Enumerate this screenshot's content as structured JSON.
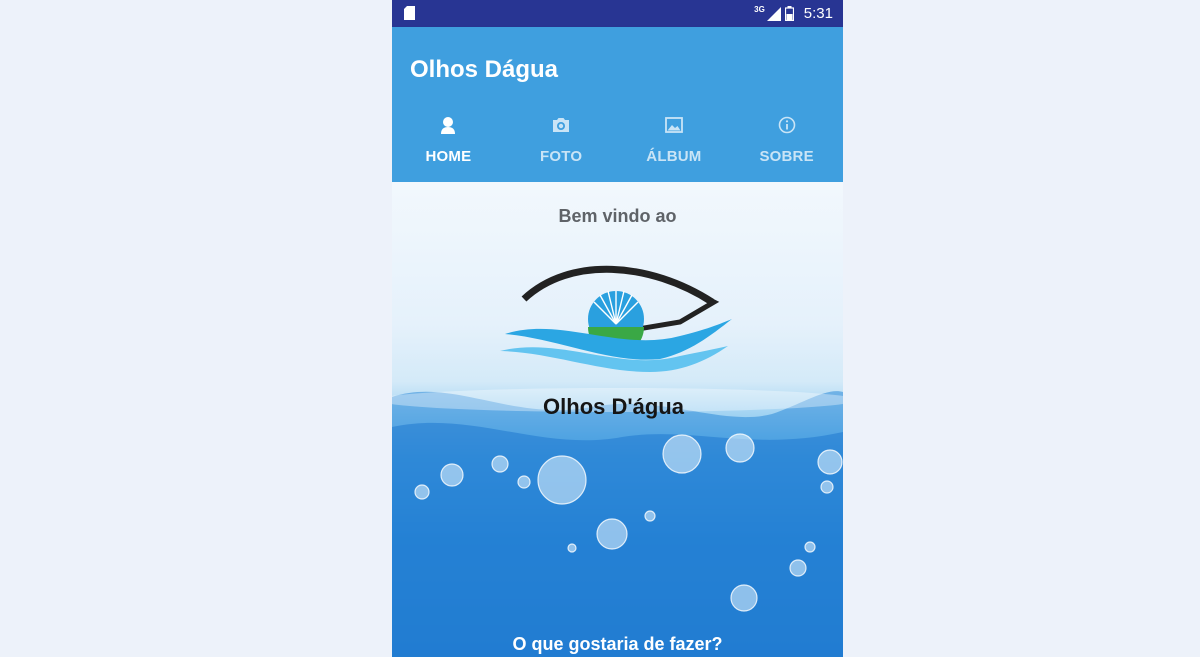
{
  "status_bar": {
    "network": "3G",
    "time": "5:31",
    "icons": [
      "sd-card-icon",
      "signal-icon",
      "battery-icon"
    ]
  },
  "app_bar": {
    "title": "Olhos Dágua",
    "background_color": "#3f9fdf"
  },
  "tabs": [
    {
      "label": "HOME",
      "icon": "person-icon",
      "active": true
    },
    {
      "label": "FOTO",
      "icon": "camera-icon",
      "active": false
    },
    {
      "label": "ÁLBUM",
      "icon": "image-icon",
      "active": false
    },
    {
      "label": "SOBRE",
      "icon": "info-icon",
      "active": false
    }
  ],
  "content": {
    "welcome": "Bem vindo ao",
    "logo_text": "Olhos D'água",
    "question": "O que gostaria de fazer?"
  },
  "colors": {
    "status_bar": "#283593",
    "accent": "#3f9fdf",
    "logo_blue": "#2aa0df",
    "logo_green": "#3aa845"
  }
}
